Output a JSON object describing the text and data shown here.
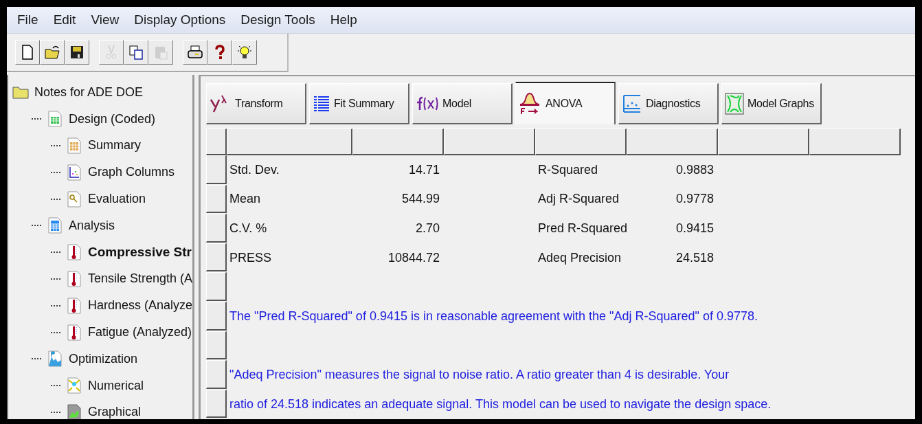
{
  "menu": [
    "File",
    "Edit",
    "View",
    "Display Options",
    "Design Tools",
    "Help"
  ],
  "toolbar": [
    [
      {
        "kind": "new",
        "disabled": false
      },
      {
        "kind": "open",
        "disabled": false
      },
      {
        "kind": "save",
        "disabled": false
      }
    ],
    [
      {
        "kind": "cut",
        "disabled": true
      },
      {
        "kind": "copy",
        "disabled": false
      },
      {
        "kind": "paste",
        "disabled": true
      }
    ],
    [
      {
        "kind": "print",
        "disabled": false
      },
      {
        "kind": "help",
        "disabled": false
      },
      {
        "kind": "tip",
        "disabled": false
      }
    ]
  ],
  "tree": {
    "label": "Notes for ADE DOE",
    "kind": "folder",
    "selected": false,
    "children": [
      {
        "label": "Design (Coded)",
        "kind": "grid",
        "selected": false,
        "children": [
          {
            "label": "Summary",
            "kind": "summary",
            "selected": false
          },
          {
            "label": "Graph Columns",
            "kind": "graph",
            "selected": false
          },
          {
            "label": "Evaluation",
            "kind": "search",
            "selected": false
          }
        ]
      },
      {
        "label": "Analysis",
        "kind": "calc",
        "selected": false,
        "children": [
          {
            "label": "Compressive Str",
            "kind": "thermo",
            "selected": true
          },
          {
            "label": "Tensile Strength (A",
            "kind": "thermo",
            "selected": false
          },
          {
            "label": "Hardness (Analyze",
            "kind": "thermo",
            "selected": false
          },
          {
            "label": "Fatigue (Analyzed)",
            "kind": "thermo",
            "selected": false
          }
        ]
      },
      {
        "label": "Optimization",
        "kind": "mountain",
        "selected": false,
        "children": [
          {
            "label": "Numerical",
            "kind": "numerical",
            "selected": false
          },
          {
            "label": "Graphical",
            "kind": "graphical",
            "selected": false
          }
        ]
      }
    ]
  },
  "tabs": [
    {
      "label": "Transform",
      "kind": "transform",
      "selected": false
    },
    {
      "label": "Fit Summary",
      "kind": "list",
      "selected": false
    },
    {
      "label": "Model",
      "kind": "fx",
      "selected": false
    },
    {
      "label": "ANOVA",
      "kind": "anova",
      "selected": true
    },
    {
      "label": "Diagnostics",
      "kind": "diag",
      "selected": false
    },
    {
      "label": "Model Graphs",
      "kind": "graphs",
      "selected": false
    }
  ],
  "rows": [
    {
      "kind": "stat",
      "cells": [
        "Std. Dev.",
        "14.71",
        "R-Squared",
        "0.9883"
      ]
    },
    {
      "kind": "stat",
      "cells": [
        "Mean",
        "544.99",
        "Adj R-Squared",
        "0.9778"
      ]
    },
    {
      "kind": "stat",
      "cells": [
        "C.V. %",
        "2.70",
        "Pred R-Squared",
        "0.9415"
      ]
    },
    {
      "kind": "stat",
      "cells": [
        "PRESS",
        "10844.72",
        "Adeq Precision",
        "24.518"
      ]
    },
    {
      "kind": "blank"
    },
    {
      "kind": "note",
      "text": "The \"Pred R-Squared\" of 0.9415 is in reasonable agreement with the \"Adj R-Squared\" of 0.9778."
    },
    {
      "kind": "blank"
    },
    {
      "kind": "note",
      "text": "\"Adeq Precision\" measures the signal to noise ratio.  A ratio greater than 4 is desirable.  Your"
    },
    {
      "kind": "note",
      "text": "ratio of 24.518 indicates an adequate signal.  This model can be used to navigate the design space."
    }
  ]
}
